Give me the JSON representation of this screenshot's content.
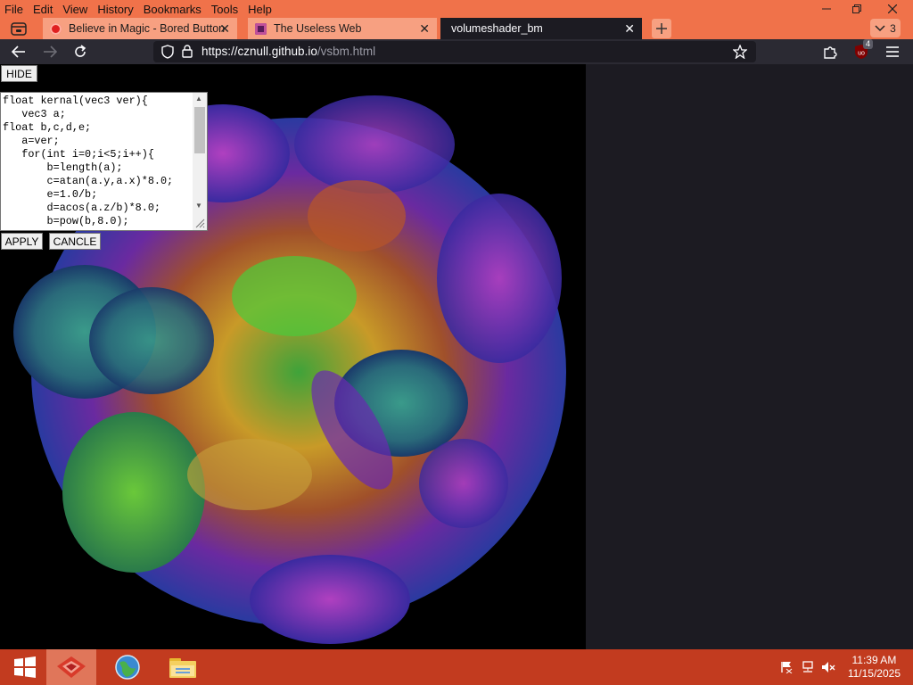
{
  "menu": [
    "File",
    "Edit",
    "View",
    "History",
    "Bookmarks",
    "Tools",
    "Help"
  ],
  "tabs": [
    {
      "title": "Believe in Magic - Bored Button",
      "close": "✕"
    },
    {
      "title": "The Useless Web",
      "close": "✕"
    },
    {
      "title": "volumeshader_bm",
      "close": "✕"
    }
  ],
  "tab_overflow_count": "3",
  "url": {
    "host": "https://cznull.github.io",
    "path": "/vsbm.html"
  },
  "page": {
    "hide_label": "HIDE",
    "apply_label": "APPLY",
    "cancel_label": "CANCLE",
    "code": "float kernal(vec3 ver){\n   vec3 a;\nfloat b,c,d,e;\n   a=ver;\n   for(int i=0;i<5;i++){\n       b=length(a);\n       c=atan(a.y,a.x)*8.0;\n       e=1.0/b;\n       d=acos(a.z/b)*8.0;\n       b=pow(b,8.0);"
  },
  "extension_badge": "4",
  "clock": {
    "time": "11:39 AM",
    "date": "11/15/2025"
  },
  "colors": {
    "accent": "#f0724a",
    "taskbar": "#c23b1f",
    "toolbar": "#2b2a33"
  }
}
